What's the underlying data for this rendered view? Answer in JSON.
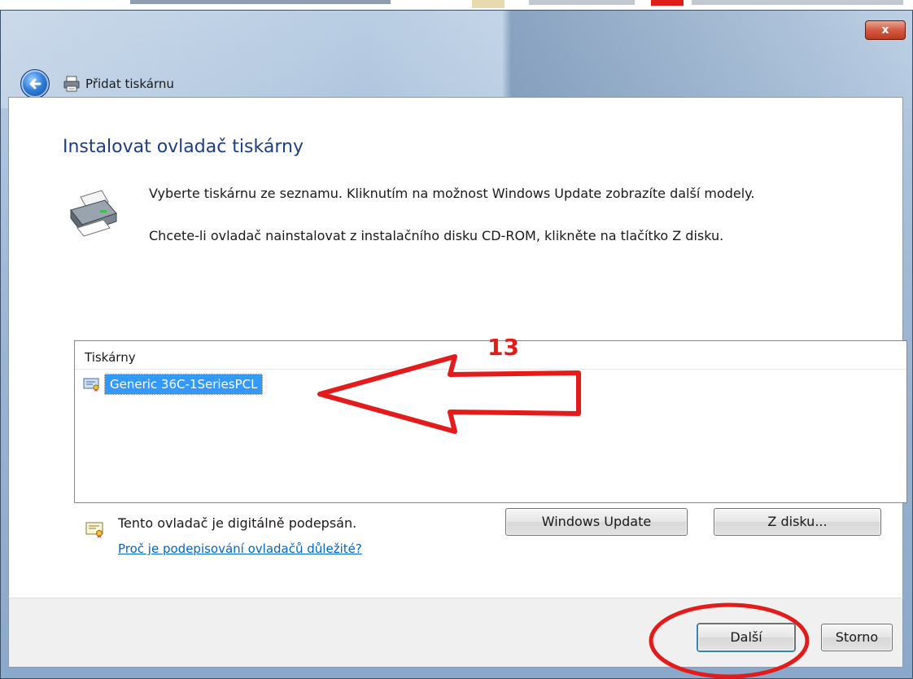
{
  "window": {
    "close_label": "x",
    "nav_title": "Přidat tiskárnu"
  },
  "content": {
    "heading": "Instalovat ovladač tiskárny",
    "description_line1": "Vyberte tiskárnu ze seznamu. Kliknutím na možnost Windows Update zobrazíte další modely.",
    "description_line2": "Chcete-li ovladač nainstalovat z instalačního disku CD-ROM, klikněte na tlačítko Z disku.",
    "printers_header": "Tiskárny",
    "printers": [
      {
        "label": "Generic 36C-1SeriesPCL",
        "selected": true
      }
    ],
    "signed_text": "Tento ovladač je digitálně podepsán.",
    "why_link": "Proč je podepisování ovladačů důležité?",
    "windows_update_button": "Windows Update",
    "from_disk_button": "Z disku..."
  },
  "footer": {
    "next_button": "Další",
    "cancel_button": "Storno"
  },
  "annotations": {
    "step_number": "13",
    "color": "#e41b1b"
  },
  "icons": {
    "back": "back-arrow-icon",
    "printer": "printer-icon",
    "certificate": "certificate-icon"
  },
  "colors": {
    "heading": "#1e3d84",
    "selection": "#3399ff",
    "link": "#0066cc"
  }
}
